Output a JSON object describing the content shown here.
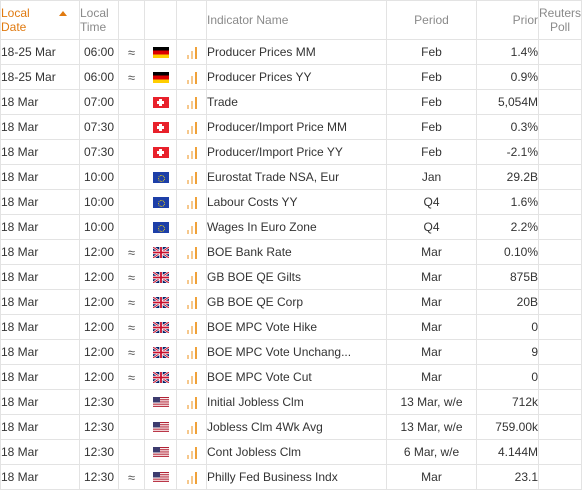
{
  "columns": {
    "local_date": "Local Date",
    "local_time": "Local Time",
    "indicator": "Indicator Name",
    "period": "Period",
    "prior": "Prior",
    "poll": "Reuters Poll"
  },
  "accent_color": "#e07a10",
  "rows": [
    {
      "date": "18-25 Mar",
      "time": "06:00",
      "approx": "≈",
      "flag": "de-flag",
      "indicator": "Producer Prices MM",
      "period": "Feb",
      "prior": "1.4%",
      "poll": ""
    },
    {
      "date": "18-25 Mar",
      "time": "06:00",
      "approx": "≈",
      "flag": "de-flag",
      "indicator": "Producer Prices YY",
      "period": "Feb",
      "prior": "0.9%",
      "poll": ""
    },
    {
      "date": "18 Mar",
      "time": "07:00",
      "approx": "",
      "flag": "ch-flag",
      "indicator": "Trade",
      "period": "Feb",
      "prior": "5,054M",
      "poll": ""
    },
    {
      "date": "18 Mar",
      "time": "07:30",
      "approx": "",
      "flag": "ch-flag",
      "indicator": "Producer/Import Price MM",
      "period": "Feb",
      "prior": "0.3%",
      "poll": ""
    },
    {
      "date": "18 Mar",
      "time": "07:30",
      "approx": "",
      "flag": "ch-flag",
      "indicator": "Producer/Import Price YY",
      "period": "Feb",
      "prior": "-2.1%",
      "poll": ""
    },
    {
      "date": "18 Mar",
      "time": "10:00",
      "approx": "",
      "flag": "eu-flag",
      "indicator": "Eurostat Trade NSA, Eur",
      "period": "Jan",
      "prior": "29.2B",
      "poll": ""
    },
    {
      "date": "18 Mar",
      "time": "10:00",
      "approx": "",
      "flag": "eu-flag",
      "indicator": "Labour Costs YY",
      "period": "Q4",
      "prior": "1.6%",
      "poll": ""
    },
    {
      "date": "18 Mar",
      "time": "10:00",
      "approx": "",
      "flag": "eu-flag",
      "indicator": "Wages In Euro Zone",
      "period": "Q4",
      "prior": "2.2%",
      "poll": ""
    },
    {
      "date": "18 Mar",
      "time": "12:00",
      "approx": "≈",
      "flag": "gb-flag",
      "indicator": "BOE Bank Rate",
      "period": "Mar",
      "prior": "0.10%",
      "poll": ""
    },
    {
      "date": "18 Mar",
      "time": "12:00",
      "approx": "≈",
      "flag": "gb-flag",
      "indicator": "GB BOE QE Gilts",
      "period": "Mar",
      "prior": "875B",
      "poll": ""
    },
    {
      "date": "18 Mar",
      "time": "12:00",
      "approx": "≈",
      "flag": "gb-flag",
      "indicator": "GB BOE QE Corp",
      "period": "Mar",
      "prior": "20B",
      "poll": ""
    },
    {
      "date": "18 Mar",
      "time": "12:00",
      "approx": "≈",
      "flag": "gb-flag",
      "indicator": "BOE MPC Vote Hike",
      "period": "Mar",
      "prior": "0",
      "poll": ""
    },
    {
      "date": "18 Mar",
      "time": "12:00",
      "approx": "≈",
      "flag": "gb-flag",
      "indicator": "BOE MPC Vote Unchang...",
      "period": "Mar",
      "prior": "9",
      "poll": ""
    },
    {
      "date": "18 Mar",
      "time": "12:00",
      "approx": "≈",
      "flag": "gb-flag",
      "indicator": "BOE MPC Vote Cut",
      "period": "Mar",
      "prior": "0",
      "poll": ""
    },
    {
      "date": "18 Mar",
      "time": "12:30",
      "approx": "",
      "flag": "us-flag",
      "indicator": "Initial Jobless Clm",
      "period": "13 Mar, w/e",
      "prior": "712k",
      "poll": ""
    },
    {
      "date": "18 Mar",
      "time": "12:30",
      "approx": "",
      "flag": "us-flag",
      "indicator": "Jobless Clm 4Wk Avg",
      "period": "13 Mar, w/e",
      "prior": "759.00k",
      "poll": ""
    },
    {
      "date": "18 Mar",
      "time": "12:30",
      "approx": "",
      "flag": "us-flag",
      "indicator": "Cont Jobless Clm",
      "period": "6 Mar, w/e",
      "prior": "4.144M",
      "poll": ""
    },
    {
      "date": "18 Mar",
      "time": "12:30",
      "approx": "≈",
      "flag": "us-flag",
      "indicator": "Philly Fed Business Indx",
      "period": "Mar",
      "prior": "23.1",
      "poll": ""
    }
  ]
}
